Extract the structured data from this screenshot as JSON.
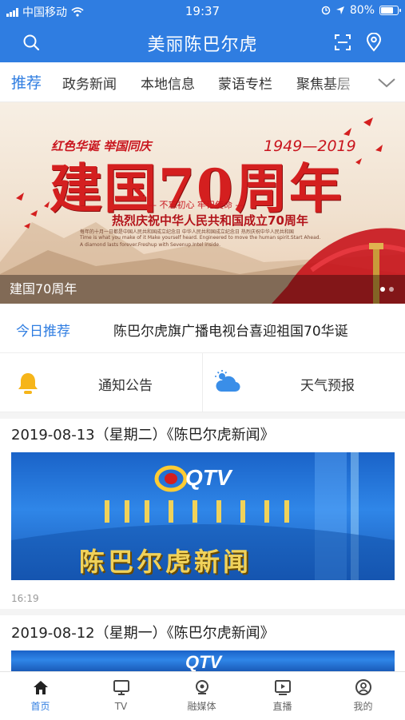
{
  "status_bar": {
    "carrier": "中国移动",
    "time": "19:37",
    "battery": "80%",
    "battery_level": 0.8
  },
  "header": {
    "title": "美丽陈巴尔虎",
    "search_icon": "search-icon",
    "scan_icon": "scan-icon",
    "location_icon": "location-pin-icon"
  },
  "tabs": [
    {
      "label": "推荐",
      "active": true
    },
    {
      "label": "政务新闻"
    },
    {
      "label": "本地信息"
    },
    {
      "label": "蒙语专栏"
    },
    {
      "label": "聚焦基层"
    }
  ],
  "banner": {
    "caption": "建国70周年",
    "poster_tag": "红色华诞 举国同庆",
    "poster_title": "建国70周年",
    "poster_years": "1949—2019",
    "poster_line": "— 不忘初心 牢记使命 —",
    "poster_sub": "热烈庆祝中华人民共和国成立70周年",
    "poster_small_1": "每年的十月一日都是中国人民共和国成立纪念日 中华人民共和国成立纪念日 热烈庆祝中华人民共和国",
    "poster_small_2": "Time is what you make of it Make yourself heard. Engineered to move the human spirit.Start Ahead.",
    "poster_small_3": "A diamond lasts forever.Freshup with Sevenup.Intel inside.",
    "page_count": 2,
    "current_page": 1
  },
  "recommend": {
    "label": "今日推荐",
    "text": "陈巴尔虎旗广播电视台喜迎祖国70华诞"
  },
  "quick_links": [
    {
      "label": "通知公告",
      "icon": "bell-icon"
    },
    {
      "label": "天气预报",
      "icon": "weather-icon"
    }
  ],
  "news": [
    {
      "title": "2019-08-13（星期二）《陈巴尔虎新闻》",
      "thumb_logo": "QTV",
      "thumb_text": "陈巴尔虎新闻",
      "time": "16:19"
    },
    {
      "title": "2019-08-12（星期一）《陈巴尔虎新闻》",
      "thumb_logo": "QTV"
    }
  ],
  "tab_bar": [
    {
      "label": "首页",
      "icon": "home-icon",
      "active": true
    },
    {
      "label": "TV",
      "icon": "tv-icon"
    },
    {
      "label": "融媒体",
      "icon": "media-icon"
    },
    {
      "label": "直播",
      "icon": "live-icon"
    },
    {
      "label": "我的",
      "icon": "profile-icon"
    }
  ],
  "colors": {
    "brand": "#2f7de1",
    "bell": "#f6b51a",
    "weather": "#3a8ee8",
    "poster_red": "#d41f1f"
  }
}
